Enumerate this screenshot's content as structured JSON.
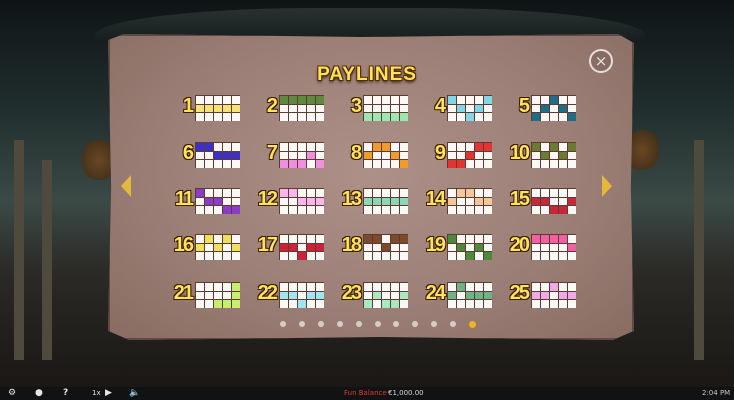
{
  "title": "PAYLINES",
  "close_glyph": "×",
  "pager": {
    "count": 11,
    "active_index": 10
  },
  "paylines": [
    {
      "n": "1",
      "color": "#f6e27a",
      "cells": [
        [
          1,
          0
        ],
        [
          1,
          1
        ],
        [
          1,
          2
        ],
        [
          1,
          3
        ],
        [
          1,
          4
        ]
      ]
    },
    {
      "n": "2",
      "color": "#5d8a3b",
      "cells": [
        [
          0,
          0
        ],
        [
          0,
          1
        ],
        [
          0,
          2
        ],
        [
          0,
          3
        ],
        [
          0,
          4
        ]
      ]
    },
    {
      "n": "3",
      "color": "#9fe5b4",
      "cells": [
        [
          2,
          0
        ],
        [
          2,
          1
        ],
        [
          2,
          2
        ],
        [
          2,
          3
        ],
        [
          2,
          4
        ]
      ]
    },
    {
      "n": "4",
      "color": "#7fd7e8",
      "cells": [
        [
          0,
          0
        ],
        [
          1,
          1
        ],
        [
          2,
          2
        ],
        [
          1,
          3
        ],
        [
          0,
          4
        ]
      ]
    },
    {
      "n": "5",
      "color": "#1f6d86",
      "cells": [
        [
          2,
          0
        ],
        [
          1,
          1
        ],
        [
          0,
          2
        ],
        [
          1,
          3
        ],
        [
          2,
          4
        ]
      ]
    },
    {
      "n": "6",
      "color": "#3c30c9",
      "cells": [
        [
          0,
          0
        ],
        [
          0,
          1
        ],
        [
          1,
          2
        ],
        [
          1,
          3
        ],
        [
          1,
          4
        ]
      ]
    },
    {
      "n": "7",
      "color": "#f28ee0",
      "cells": [
        [
          2,
          0
        ],
        [
          2,
          1
        ],
        [
          2,
          2
        ],
        [
          1,
          3
        ],
        [
          2,
          4
        ]
      ]
    },
    {
      "n": "8",
      "color": "#f29a2c",
      "cells": [
        [
          1,
          0
        ],
        [
          0,
          1
        ],
        [
          0,
          2
        ],
        [
          1,
          3
        ],
        [
          2,
          4
        ]
      ]
    },
    {
      "n": "9",
      "color": "#e53232",
      "cells": [
        [
          2,
          0
        ],
        [
          2,
          1
        ],
        [
          1,
          2
        ],
        [
          0,
          3
        ],
        [
          0,
          4
        ]
      ]
    },
    {
      "n": "10",
      "color": "#6b7c32",
      "cells": [
        [
          0,
          0
        ],
        [
          1,
          1
        ],
        [
          0,
          2
        ],
        [
          1,
          3
        ],
        [
          0,
          4
        ]
      ]
    },
    {
      "n": "11",
      "color": "#8a3cc9",
      "cells": [
        [
          0,
          0
        ],
        [
          1,
          1
        ],
        [
          1,
          2
        ],
        [
          2,
          3
        ],
        [
          2,
          4
        ]
      ]
    },
    {
      "n": "12",
      "color": "#f7b6ee",
      "cells": [
        [
          0,
          0
        ],
        [
          0,
          1
        ],
        [
          1,
          2
        ],
        [
          1,
          3
        ],
        [
          1,
          4
        ]
      ]
    },
    {
      "n": "13",
      "color": "#8ad8b6",
      "cells": [
        [
          1,
          0
        ],
        [
          1,
          1
        ],
        [
          1,
          2
        ],
        [
          1,
          3
        ],
        [
          1,
          4
        ]
      ]
    },
    {
      "n": "14",
      "color": "#f3c79a",
      "cells": [
        [
          1,
          0
        ],
        [
          0,
          1
        ],
        [
          0,
          2
        ],
        [
          1,
          3
        ],
        [
          1,
          4
        ]
      ]
    },
    {
      "n": "15",
      "color": "#c5283d",
      "cells": [
        [
          1,
          0
        ],
        [
          1,
          1
        ],
        [
          2,
          2
        ],
        [
          2,
          3
        ],
        [
          1,
          4
        ]
      ]
    },
    {
      "n": "16",
      "color": "#efe05a",
      "cells": [
        [
          1,
          0
        ],
        [
          0,
          1
        ],
        [
          1,
          2
        ],
        [
          0,
          3
        ],
        [
          1,
          4
        ]
      ]
    },
    {
      "n": "17",
      "color": "#d0203a",
      "cells": [
        [
          1,
          0
        ],
        [
          1,
          1
        ],
        [
          2,
          2
        ],
        [
          1,
          3
        ],
        [
          1,
          4
        ]
      ]
    },
    {
      "n": "18",
      "color": "#7a4a2a",
      "cells": [
        [
          0,
          0
        ],
        [
          0,
          1
        ],
        [
          1,
          2
        ],
        [
          0,
          3
        ],
        [
          0,
          4
        ]
      ]
    },
    {
      "n": "19",
      "color": "#4a8a3a",
      "cells": [
        [
          0,
          0
        ],
        [
          1,
          1
        ],
        [
          2,
          2
        ],
        [
          1,
          3
        ],
        [
          2,
          4
        ]
      ]
    },
    {
      "n": "20",
      "color": "#f45fa3",
      "cells": [
        [
          0,
          0
        ],
        [
          0,
          1
        ],
        [
          0,
          2
        ],
        [
          0,
          3
        ],
        [
          1,
          4
        ]
      ]
    },
    {
      "n": "21",
      "color": "#c7ee6d",
      "cells": [
        [
          0,
          4
        ],
        [
          1,
          4
        ],
        [
          2,
          4
        ],
        [
          2,
          3
        ],
        [
          2,
          2
        ]
      ]
    },
    {
      "n": "22",
      "color": "#9fe6f0",
      "cells": [
        [
          1,
          0
        ],
        [
          1,
          1
        ],
        [
          2,
          2
        ],
        [
          1,
          3
        ],
        [
          1,
          4
        ]
      ]
    },
    {
      "n": "23",
      "color": "#a7eac2",
      "cells": [
        [
          2,
          0
        ],
        [
          1,
          1
        ],
        [
          2,
          2
        ],
        [
          2,
          3
        ],
        [
          1,
          4
        ]
      ]
    },
    {
      "n": "24",
      "color": "#6cb488",
      "cells": [
        [
          1,
          0
        ],
        [
          0,
          1
        ],
        [
          1,
          2
        ],
        [
          1,
          3
        ],
        [
          1,
          4
        ]
      ]
    },
    {
      "n": "25",
      "color": "#f0a8e8",
      "cells": [
        [
          1,
          0
        ],
        [
          1,
          1
        ],
        [
          0,
          2
        ],
        [
          1,
          3
        ],
        [
          1,
          4
        ]
      ]
    }
  ],
  "bottom_bar": {
    "speed": "1x",
    "balance_label": "Fun Balance",
    "balance_value": "€1,000.00",
    "time": "2:04 PM"
  },
  "icons": [
    "gear-icon",
    "chat-icon",
    "help-icon",
    "play-icon",
    "sound-icon",
    "close-icon",
    "arrow-left-icon",
    "arrow-right-icon"
  ]
}
